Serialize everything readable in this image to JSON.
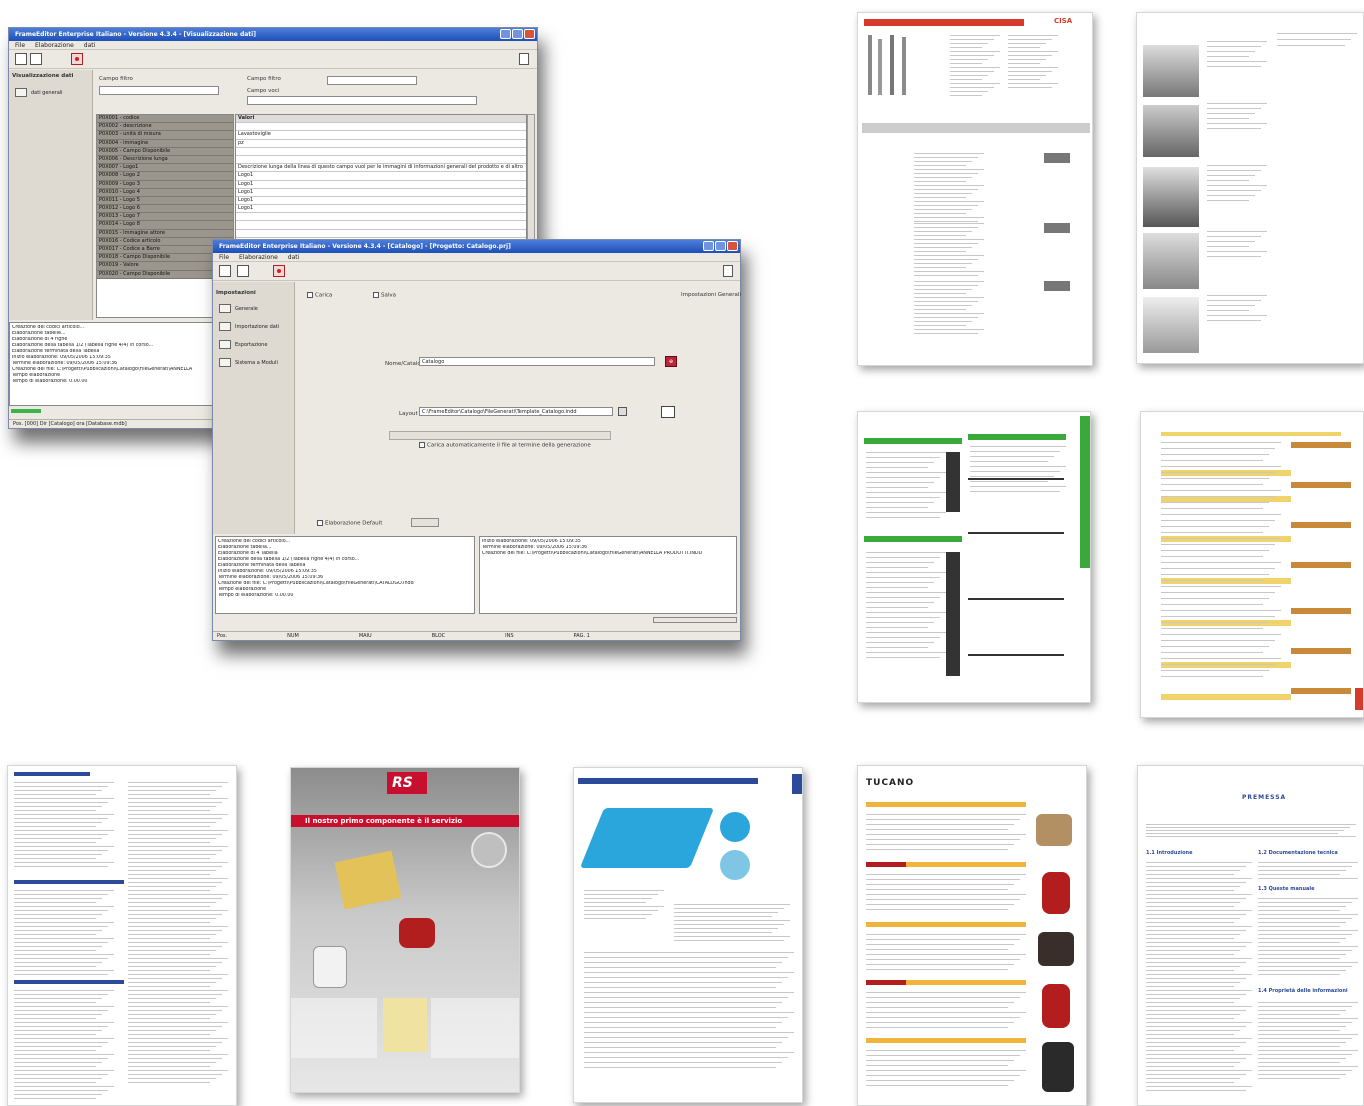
{
  "window_back": {
    "title": "FrameEditor Enterprise Italiano - Versione 4.3.4 - [Visualizzazione dati]",
    "menu": [
      "File",
      "Elaborazione",
      "dati"
    ],
    "nav_title": "Visualizzazione dati",
    "nav_item": "dati generali",
    "label_campo_filtro": "Campo filtro",
    "label_campo_testo": "Campo filtro",
    "label_campo_voci": "Campo voci",
    "field_names": [
      "P0X001 - codice",
      "P0X002 - descrizione",
      "P0X003 - unità di misura",
      "P0X004 - immagine",
      "P0X005 - Campo Disponibile",
      "P0X006 - Descrizione lunga",
      "P0X007 - Logo1",
      "P0X008 - Logo 2",
      "P0X009 - Logo 3",
      "P0X010 - Logo 4",
      "P0X011 - Logo 5",
      "P0X012 - Logo 6",
      "P0X013 - Logo 7",
      "P0X014 - Logo 8",
      "P0X015 - Immagine attore",
      "P0X016 - Codice articolo",
      "P0X017 - Codice a Barre",
      "P0X018 - Campo Disponibile",
      "P0X019 - Valore",
      "P0X020 - Campo Disponibile"
    ],
    "values_header": "Valori",
    "values": [
      "",
      "Lavastoviglie",
      "pz",
      "",
      "",
      "Descrizione lunga della linea di questo campo vuoi per le immagini di informazioni generali del prodotto e di altro",
      "Logo1",
      "Logo1",
      "Logo1",
      "Logo1",
      "Logo1",
      "",
      "",
      "",
      "",
      "",
      "",
      "",
      "",
      ""
    ],
    "log": [
      "Creazione dei codici articolo...",
      "Elaborazione tabelle...",
      "Elaborazione di 4 righe",
      "Elaborazione della tabella 1/2 (Tabella righe 4/4) in corso...",
      "Elaborazione terminata della Tabella",
      "Inizio elaborazione: 09/05/2006 15:09:35",
      "Termine elaborazione: 09/05/2006 15:09:36",
      "Creazione del file: C:\\Progetti\\Pubblicazioni\\Catalogo\\FileGenerati\\ANNELLA",
      "Tempo elaborazione",
      "Tempo di elaborazione: 0.00.00"
    ],
    "status": "Pos. [000] Dir [Catalogo] ora [Database.mdb]"
  },
  "window_front": {
    "title": "FrameEditor Enterprise Italiano - Versione 4.3.4 - [Catalogo] - [Progetto: Catalogo.prj]",
    "menu": [
      "File",
      "Elaborazione",
      "dati"
    ],
    "nav_title": "Impostazioni",
    "nav_items": [
      "Generale",
      "Importazione dati",
      "Esportazione",
      "Sistema a Moduli"
    ],
    "tab_1": "Carica",
    "tab_2": "Salva",
    "right_header": "Impostazioni Generali",
    "label_nome": "Nome/Catalogo",
    "value_nome": "Catalogo",
    "label_layout": "Layout",
    "value_layout": "C:\\FrameEditor\\Catalogo\\FileGenerati\\Template_Catalogo.indd",
    "checkbox_label": "Carica automaticamente il file al termine della generazione",
    "bottom_checkbox": "Elaborazione Default",
    "log_left": [
      "Creazione dei codici articolo...",
      "Elaborazione tabella...",
      "Elaborazione di 4 Tabella",
      "Elaborazione della tabella 1/2 (Tabella righe 4/4) in corso...",
      "Elaborazione terminata della Tabella",
      "Inizio elaborazione: 09/05/2006 15:09:35",
      "Termine elaborazione: 09/05/2006 15:09:36",
      "Creazione del file: C:\\Progetti\\Pubblicazioni\\Catalogo\\FileGenerati\\CATALOGO.indd",
      "Tempo elaborazione",
      "Tempo di elaborazione: 0.00.00"
    ],
    "log_right": [
      "Inizio elaborazione: 09/05/2006 15:09:35",
      "Termine elaborazione: 09/05/2006 15:09:36",
      "Creazione del file: C:\\Progetti\\Pubblicazioni\\Catalogo\\FileGenerati\\ANNELLA PRODOTTI.INDD"
    ],
    "status": [
      "Pos.",
      "NUM",
      "MAIU",
      "BLOC",
      "INS",
      "PAG. 1"
    ]
  },
  "pages": {
    "cisa_logo": "CISA",
    "rs_logo": "RS",
    "rs_headline": "Il nostro primo componente è il servizio",
    "tucano_logo": "TUCANO",
    "premessa_title": "PREMESSA",
    "premessa_sections": [
      "1.1 Introduzione",
      "1.2 Documentazione tecnica",
      "1.3 Queste manuale",
      "1.4 Proprietà delle informazioni"
    ]
  },
  "colors": {
    "titlebar": "#1d4fb8",
    "rs_red": "#c8102e",
    "cisa_red": "#d53a2a",
    "green_bar": "#3aa83a",
    "wrench_yellow": "#f1d36b",
    "tucano_yellow": "#f0b43a",
    "blue_mat": "#2aa6dc"
  }
}
